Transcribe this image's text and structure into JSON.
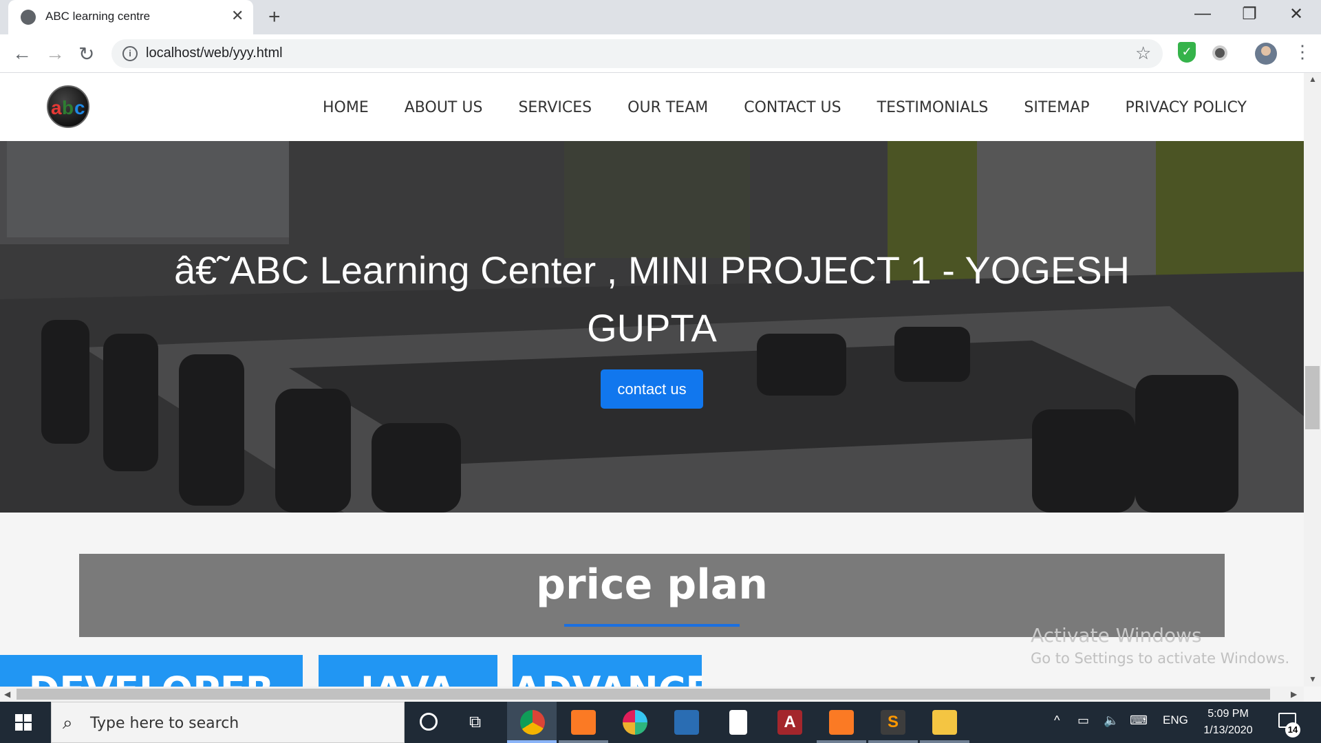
{
  "browser": {
    "tab_title": "ABC learning centre",
    "tab_close": "✕",
    "new_tab": "+",
    "url": "localhost/web/yyy.html",
    "window_controls": [
      "—",
      "❐",
      "✕"
    ],
    "nav_icons": [
      "back-icon",
      "forward-icon",
      "reload-icon"
    ]
  },
  "site": {
    "logo_letters": [
      "a",
      "b",
      "c"
    ],
    "logo_colors": [
      "#e53935",
      "#2e7d32",
      "#1e88e5"
    ],
    "nav": [
      "HOME",
      "ABOUT US",
      "SERVICES",
      "OUR TEAM",
      "CONTACT US",
      "TESTIMONIALS",
      "SITEMAP",
      "PRIVACY POLICY"
    ],
    "hero_title": "â€˜ABC Learning Center , MINI PROJECT 1 - YOGESH GUPTA",
    "hero_button": "contact us",
    "price_title": "price plan",
    "cards": [
      "DEVELOPER",
      "JAVA",
      "ADVANCED"
    ]
  },
  "watermark": {
    "line1": "Activate Windows",
    "line2": "Go to Settings to activate Windows."
  },
  "taskbar": {
    "search_placeholder": "Type here to search",
    "lang": "ENG",
    "time": "5:09 PM",
    "date": "1/13/2020",
    "notifications": "14",
    "apps": [
      "chrome",
      "xampp",
      "slack",
      "virtualbox",
      "notepad",
      "access",
      "xampp-control",
      "sublime-text",
      "file-explorer"
    ]
  },
  "colors": {
    "accent_button": "#1177ee",
    "card_blue": "#2196f3",
    "price_box": "#7a7a7a",
    "taskbar": "#1f2a36"
  }
}
